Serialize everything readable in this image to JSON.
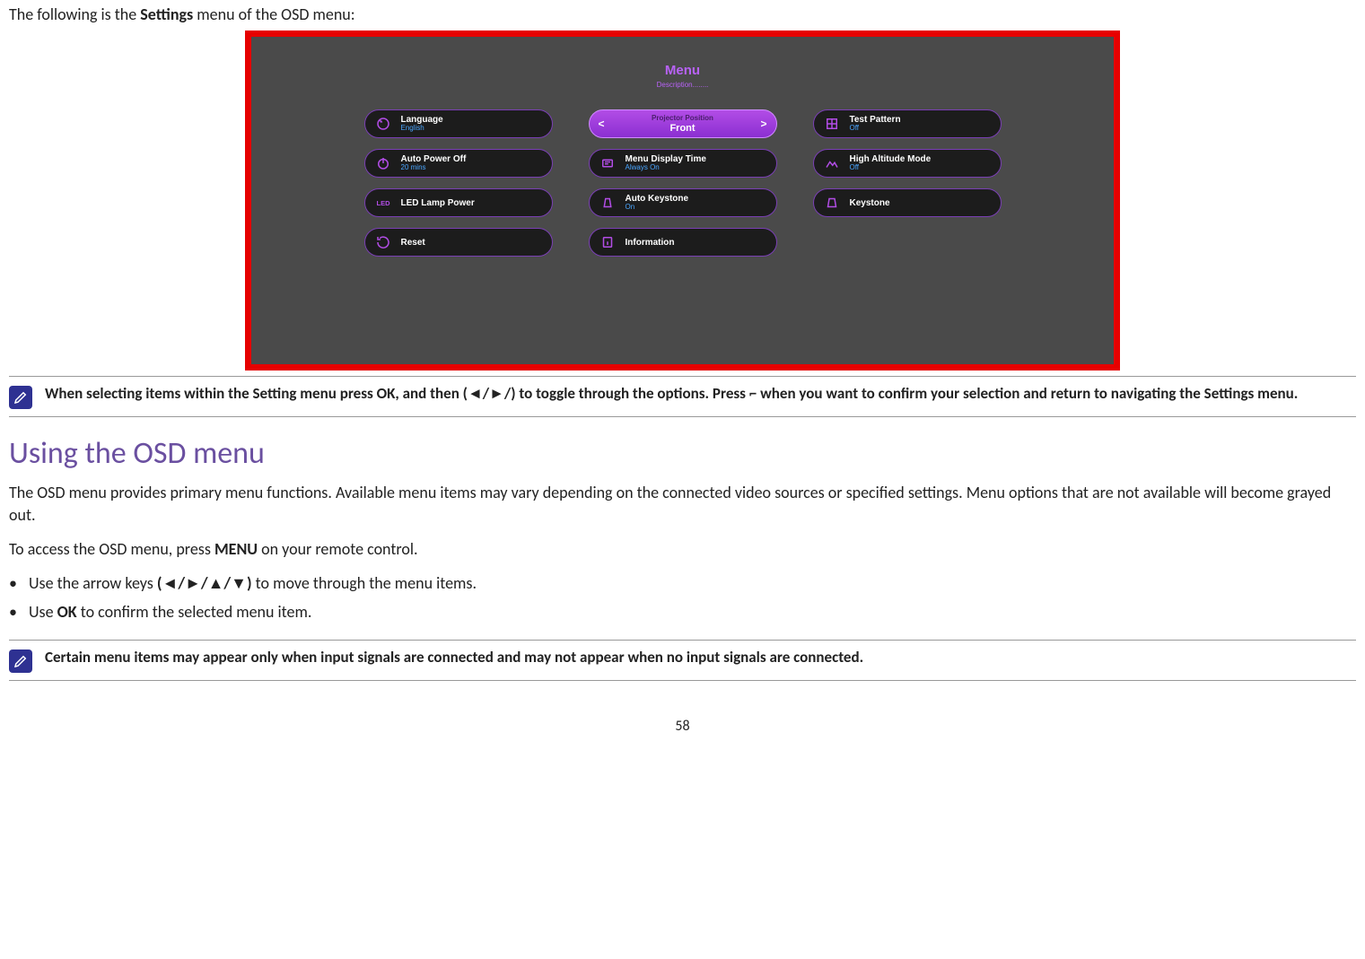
{
  "intro": {
    "prefix": "The following is the ",
    "bold": "Settings",
    "suffix": " menu of the OSD menu:"
  },
  "osd": {
    "title": "Menu",
    "subtitle": "Description........",
    "columns": [
      [
        {
          "icon": "language-icon",
          "label": "Language",
          "value": "English"
        },
        {
          "icon": "power-icon",
          "label": "Auto Power Off",
          "value": "20 mins"
        },
        {
          "icon": "led-icon",
          "label": "LED Lamp Power",
          "value": ""
        },
        {
          "icon": "reset-icon",
          "label": "Reset",
          "value": ""
        }
      ],
      [
        {
          "icon": "position-icon",
          "label": "Projector Position",
          "value": "Front",
          "selected": true
        },
        {
          "icon": "timer-icon",
          "label": "Menu Display Time",
          "value": "Always On"
        },
        {
          "icon": "autokeystone-icon",
          "label": "Auto Keystone",
          "value": "On"
        },
        {
          "icon": "info-icon",
          "label": "Information",
          "value": ""
        }
      ],
      [
        {
          "icon": "grid-icon",
          "label": "Test Pattern",
          "value": "Off"
        },
        {
          "icon": "altitude-icon",
          "label": "High Altitude Mode",
          "value": "Off"
        },
        {
          "icon": "keystone-icon",
          "label": "Keystone",
          "value": ""
        }
      ]
    ]
  },
  "note1": "When selecting items within the Setting menu press OK, and then (◄/►/) to toggle through the options. Press ⌐ when you want to confirm your selection and return to navigating the Settings menu.",
  "heading": "Using the OSD menu",
  "para1": "The OSD menu provides primary menu functions. Available menu items may vary depending on the connected video sources or specified settings. Menu options that are not available will become grayed out.",
  "para2_prefix": "To access the OSD menu, press ",
  "para2_bold": "MENU",
  "para2_suffix": " on your remote control.",
  "bullets": [
    {
      "prefix": "Use the arrow keys ",
      "bold": "(◄/►/▲/▼)",
      "suffix": " to move through the menu items."
    },
    {
      "prefix": "Use ",
      "bold": "OK",
      "suffix": " to confirm the selected menu item."
    }
  ],
  "note2": "Certain menu items may appear only when input signals are connected and may not appear when no input signals are connected.",
  "page_number": "58"
}
